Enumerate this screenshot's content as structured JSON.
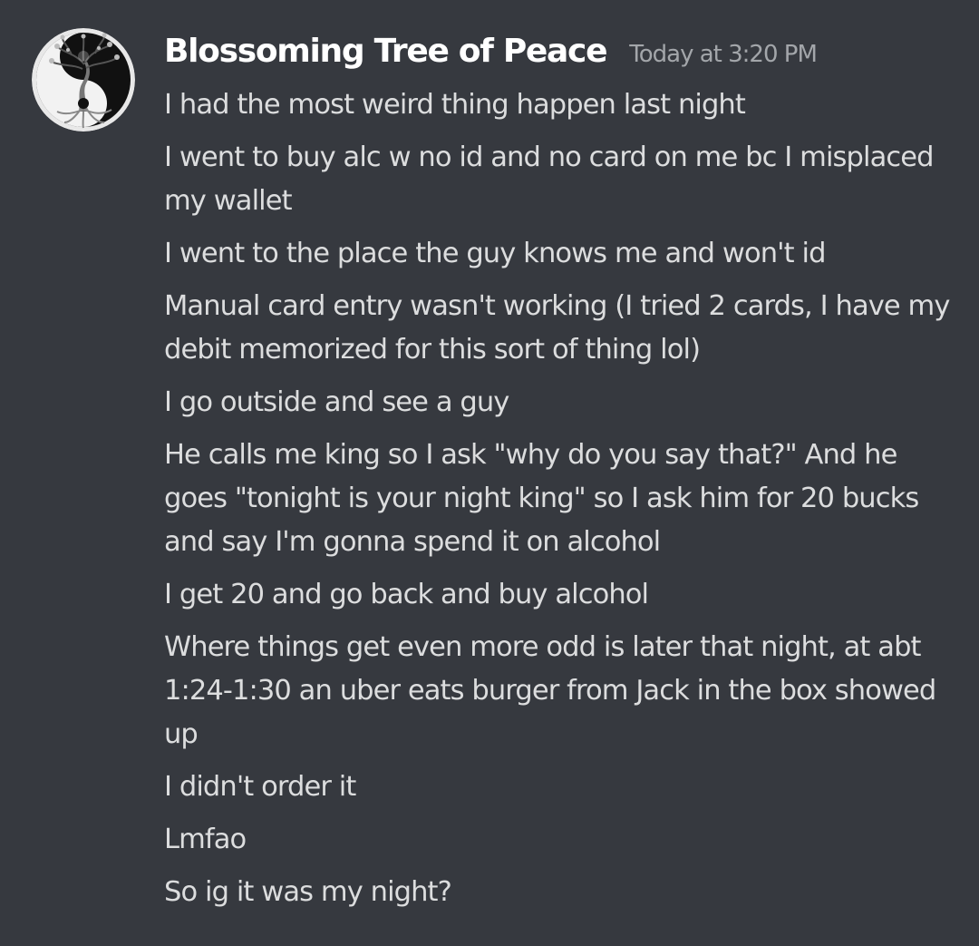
{
  "author": {
    "name": "Blossoming Tree of Peace",
    "timestamp": "Today at 3:20 PM",
    "avatar_icon": "yin-yang-tree-icon"
  },
  "colors": {
    "background": "#36393f",
    "username": "#ffffff",
    "message_text": "#dcddde",
    "timestamp": "#a3a6aa"
  },
  "messages": [
    "I had the most weird thing happen last night",
    "I went to buy alc w no id and no card on me bc I misplaced my wallet",
    "I went to the place the guy knows me and won't id",
    "Manual card entry wasn't working (I tried 2 cards, I have my debit memorized for this sort of thing lol)",
    "I go outside and see a guy",
    "He calls me king so I ask \"why do you say that?\" And he goes \"tonight is your night king\" so I ask him for 20 bucks and say I'm gonna spend it on alcohol",
    "I get 20 and go back and buy alcohol",
    "Where things get even more odd is later that night, at abt 1:24-1:30 an uber eats burger from Jack in the box showed up",
    "I didn't order it",
    "Lmfao",
    "So ig it was my night?"
  ]
}
